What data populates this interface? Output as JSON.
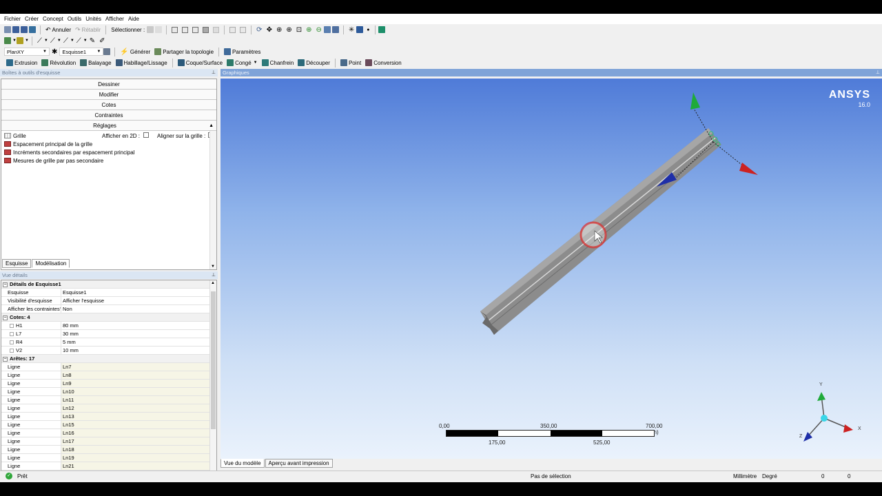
{
  "menu": [
    "Fichier",
    "Créer",
    "Concept",
    "Outils",
    "Unités",
    "Afficher",
    "Aide"
  ],
  "toolbar1": {
    "undo_label": "Annuler",
    "redo_label": "Rétablir",
    "select_label": "Sélectionner :"
  },
  "toolbar3": {
    "plane_combo": "PlanXY",
    "sketch_combo": "Esquisse1",
    "generate_label": "Générer",
    "share_topology_label": "Partager la topologie",
    "parameters_label": "Paramètres"
  },
  "toolbar4": {
    "extrude_label": "Extrusion",
    "revolve_label": "Révolution",
    "sweep_label": "Balayage",
    "skin_loft_label": "Habillage/Lissage",
    "shell_label": "Coque/Surface",
    "blend_label": "Congé",
    "chamfer_label": "Chanfrein",
    "slice_label": "Découper",
    "point_label": "Point",
    "conversion_label": "Conversion"
  },
  "sketch_toolbox": {
    "title": "Boîtes à outils d'esquisse",
    "sections": [
      "Dessiner",
      "Modifier",
      "Cotes",
      "Contraintes",
      "Réglages"
    ],
    "settings": [
      {
        "label": "Grille",
        "show_2d_label": "Afficher en 2D :",
        "snap_label": "Aligner sur la grille :"
      },
      {
        "label": "Espacement principal de la grille"
      },
      {
        "label": "Incréments secondaires par espacement principal"
      },
      {
        "label": "Mesures de grille par pas secondaire"
      }
    ],
    "snap_checked": "✓",
    "tabs": [
      "Esquisse",
      "Modélisation"
    ]
  },
  "details": {
    "title": "Vue détails",
    "group_header": "Détails de Esquisse1",
    "rows": [
      {
        "k": "Esquisse",
        "v": "Esquisse1"
      },
      {
        "k": "Visibilité d'esquisse",
        "v": "Afficher l'esquisse"
      },
      {
        "k": "Afficher les contraintes?",
        "v": "Non"
      }
    ],
    "dims_header": "Cotes: 4",
    "dims": [
      {
        "k": "H1",
        "v": "80 mm"
      },
      {
        "k": "L7",
        "v": "30 mm"
      },
      {
        "k": "R4",
        "v": "5 mm"
      },
      {
        "k": "V2",
        "v": "10 mm"
      }
    ],
    "edges_header": "Arêtes: 17",
    "edges": [
      {
        "k": "Ligne",
        "v": "Ln7"
      },
      {
        "k": "Ligne",
        "v": "Ln8"
      },
      {
        "k": "Ligne",
        "v": "Ln9"
      },
      {
        "k": "Ligne",
        "v": "Ln10"
      },
      {
        "k": "Ligne",
        "v": "Ln11"
      },
      {
        "k": "Ligne",
        "v": "Ln12"
      },
      {
        "k": "Ligne",
        "v": "Ln13"
      },
      {
        "k": "Ligne",
        "v": "Ln15"
      },
      {
        "k": "Ligne",
        "v": "Ln16"
      },
      {
        "k": "Ligne",
        "v": "Ln17"
      },
      {
        "k": "Ligne",
        "v": "Ln18"
      },
      {
        "k": "Ligne",
        "v": "Ln19"
      },
      {
        "k": "Ligne",
        "v": "Ln21"
      }
    ]
  },
  "graphics": {
    "title": "Graphiques",
    "brand": "ANSYS",
    "version": "16.0",
    "scale_top": [
      "0,00",
      "350,00",
      "700,00 (mm)"
    ],
    "scale_bottom": [
      "175,00",
      "525,00"
    ],
    "triad": {
      "x": "X",
      "y": "Y",
      "z": "Z"
    },
    "tabs": [
      "Vue du modèle",
      "Aperçu avant impression"
    ]
  },
  "status": {
    "ready": "Prêt",
    "selection": "Pas de sélection",
    "units_length": "Millimètre",
    "units_angle": "Degré",
    "count1": "0",
    "count2": "0"
  }
}
